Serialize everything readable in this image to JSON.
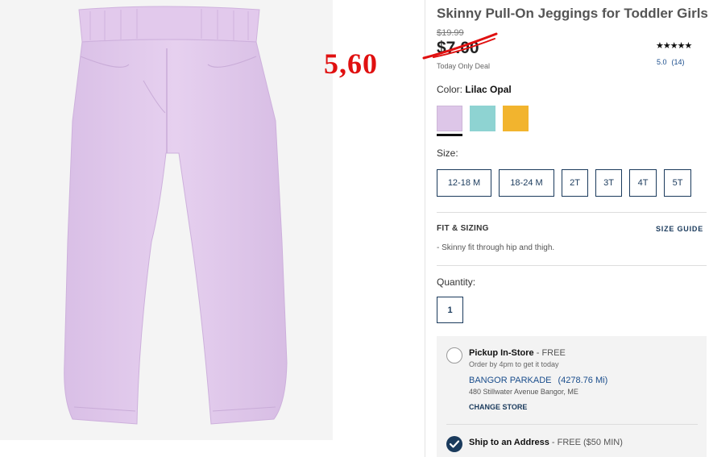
{
  "annotation": {
    "handwritten_price": "5,60"
  },
  "product": {
    "title": "Skinny Pull-On Jeggings for Toddler Girls",
    "original_price": "$19.99",
    "sale_price": "$7.00",
    "deal_label": "Today Only Deal",
    "stars": "★★★★★",
    "rating": "5.0",
    "review_count": "(14)"
  },
  "color": {
    "label": "Color:",
    "selected": "Lilac Opal",
    "swatches": [
      {
        "name": "Lilac Opal",
        "hex": "#ddc6e8",
        "selected": true
      },
      {
        "name": "Aqua",
        "hex": "#8ed3d2",
        "selected": false
      },
      {
        "name": "Gold",
        "hex": "#f2b42e",
        "selected": false
      }
    ]
  },
  "size": {
    "label": "Size:",
    "options": [
      "12-18 M",
      "18-24 M",
      "2T",
      "3T",
      "4T",
      "5T"
    ]
  },
  "fit": {
    "title": "FIT & SIZING",
    "size_guide": "SIZE GUIDE",
    "note": "Skinny fit through hip and thigh."
  },
  "quantity": {
    "label": "Quantity:",
    "value": "1"
  },
  "fulfillment": {
    "pickup_title": "Pickup In-Store",
    "pickup_suffix": " - FREE",
    "pickup_sub": "Order by 4pm to get it today",
    "store_name": "BANGOR PARKADE",
    "store_distance": "(4278.76 Mi)",
    "store_address": "480 Stillwater Avenue Bangor, ME",
    "change_store": "CHANGE STORE",
    "ship_title": "Ship to an Address",
    "ship_suffix": " - FREE ($50 MIN)"
  },
  "colors": {
    "accent": "#1a3a5c",
    "link": "#1a4d8c",
    "annotation_red": "#e01010"
  }
}
